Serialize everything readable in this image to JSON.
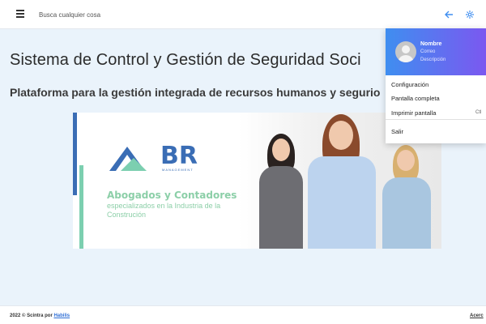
{
  "topbar": {
    "menu_icon": "hamburger-icon",
    "search_placeholder": "Busca cualquier cosa",
    "back_icon": "arrow-left-icon",
    "settings_icon": "gear-icon"
  },
  "main": {
    "title": "Sistema de Control y Gestión de Seguridad Soci",
    "subtitle": "Plataforma para la gestión integrada de recursos humanos y segurio"
  },
  "banner": {
    "logo_text": "BR",
    "logo_sub": "MANAGEMENT",
    "heading": "Abogados y Contadores",
    "description": "especializados en la Industria de la Construción"
  },
  "profile_menu": {
    "name": "Nombre",
    "email": "Correo",
    "description": "Descripción",
    "items": [
      {
        "label": "Configuración",
        "shortcut": ""
      },
      {
        "label": "Pantalla completa",
        "shortcut": ""
      },
      {
        "label": "Imprimir pantalla",
        "shortcut": "Ctl"
      },
      {
        "label": "Salir",
        "shortcut": ""
      }
    ]
  },
  "footer": {
    "copyright": "2022 © Scintra por",
    "company_link": "Habilis",
    "right_link": "Acerc"
  },
  "colors": {
    "accent": "#3a6db5",
    "header_gradient_start": "#3f8ef0",
    "header_gradient_end": "#7b58f0",
    "banner_green": "#8ccfa8"
  }
}
